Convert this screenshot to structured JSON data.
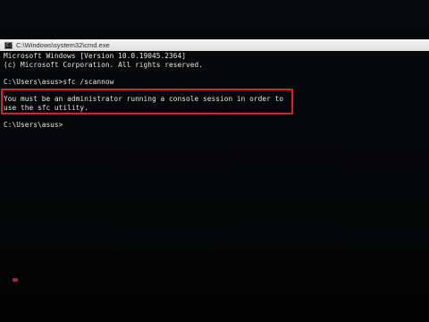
{
  "window": {
    "title": "C:\\Windows\\system32\\cmd.exe",
    "icon": "cmd-icon",
    "icon_text": "C:\\"
  },
  "console": {
    "lines": [
      "Microsoft Windows [Version 10.0.19045.2364]",
      "(c) Microsoft Corporation. All rights reserved.",
      "",
      "C:\\Users\\asus>sfc /scannow",
      "",
      "You must be an administrator running a console session in order to",
      "use the sfc utility.",
      "",
      "C:\\Users\\asus>"
    ]
  },
  "colors": {
    "highlight_border": "#d9232c",
    "console_background": "#050607",
    "console_text": "#e9e9e9"
  }
}
